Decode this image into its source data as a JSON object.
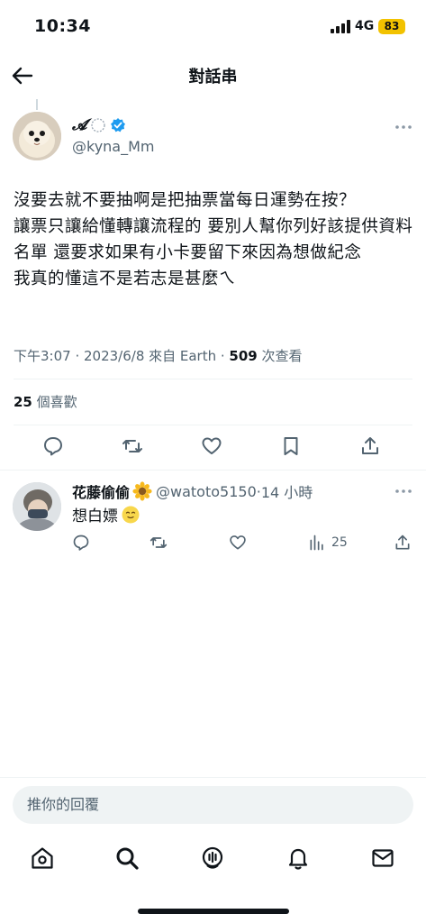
{
  "status_bar": {
    "time": "10:34",
    "network": "4G",
    "battery": "83"
  },
  "header": {
    "title": "對話串",
    "back_icon": "arrow-left-icon"
  },
  "tweet": {
    "author_name": "𝓐",
    "author_handle": "@kyna_Mm",
    "verified": true,
    "text": "沒要去就不要抽啊是把抽票當每日運勢在按？\n讓票只讓給懂轉讓流程的 要別人幫你列好該提供資料名單 還要求如果有小卡要留下來因為想做紀念\n我真的懂這不是若志是甚麼ㄟ",
    "meta_prefix": "下午3:07 · 2023/6/8 來自 Earth · ",
    "view_count": "509",
    "view_suffix": " 次查看",
    "likes_count": "25",
    "likes_label": " 個喜歡",
    "actions": [
      "reply-icon",
      "retweet-icon",
      "like-icon",
      "bookmark-icon",
      "share-icon"
    ]
  },
  "reply": {
    "author_name": "花藤偷偷",
    "author_handle": "@watoto5150",
    "time": "14 小時",
    "time_separator": " · ",
    "text": "想白嫖",
    "view_count": "25",
    "actions": [
      "reply-icon",
      "retweet-icon",
      "like-icon",
      "views-icon",
      "share-icon"
    ]
  },
  "composer": {
    "placeholder": "推你的回覆"
  },
  "bottom_nav": [
    "home-icon",
    "search-icon",
    "spaces-icon",
    "notifications-icon",
    "messages-icon"
  ],
  "colors": {
    "text": "#0f1419",
    "secondary": "#536471",
    "verified": "#1d9bf0",
    "battery": "#f2c200",
    "divider": "#eff3f4"
  }
}
